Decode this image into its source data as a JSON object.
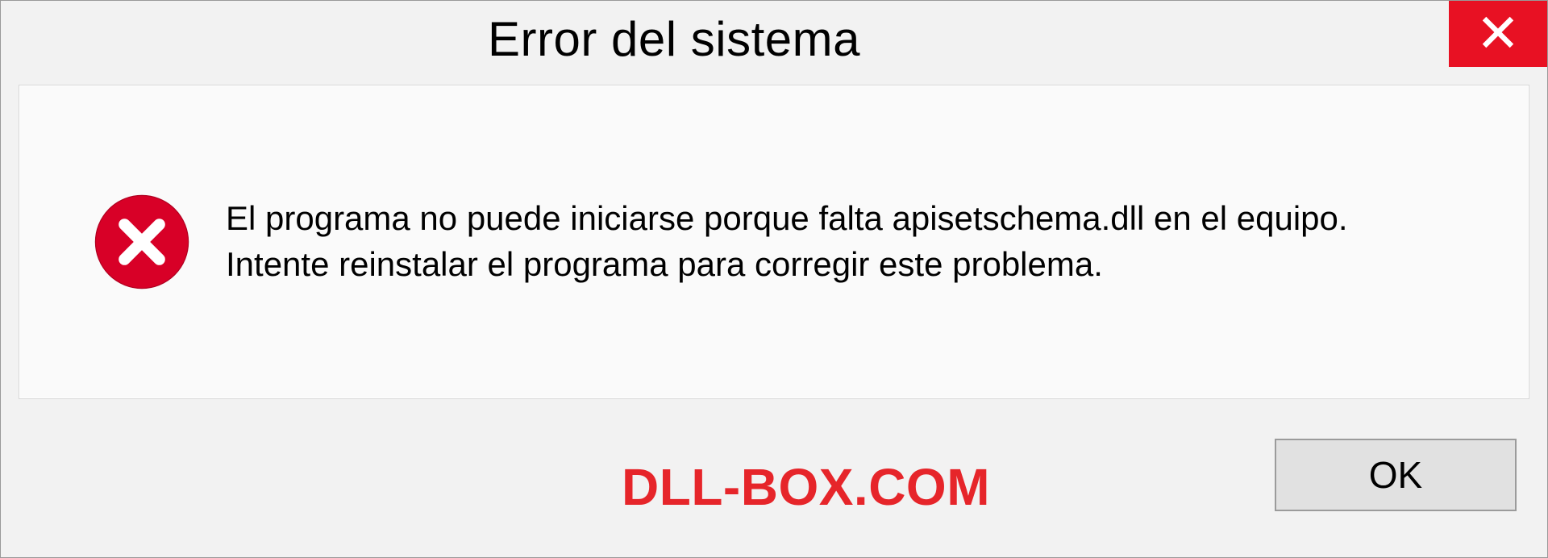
{
  "dialog": {
    "title": "Error del sistema",
    "message": "El programa no puede iniciarse porque falta apisetschema.dll en el equipo. Intente reinstalar el programa para corregir este problema.",
    "ok_label": "OK"
  },
  "watermark": "DLL-BOX.COM",
  "colors": {
    "close_bg": "#e81123",
    "error_red": "#d80027",
    "watermark_red": "#e6252a"
  }
}
